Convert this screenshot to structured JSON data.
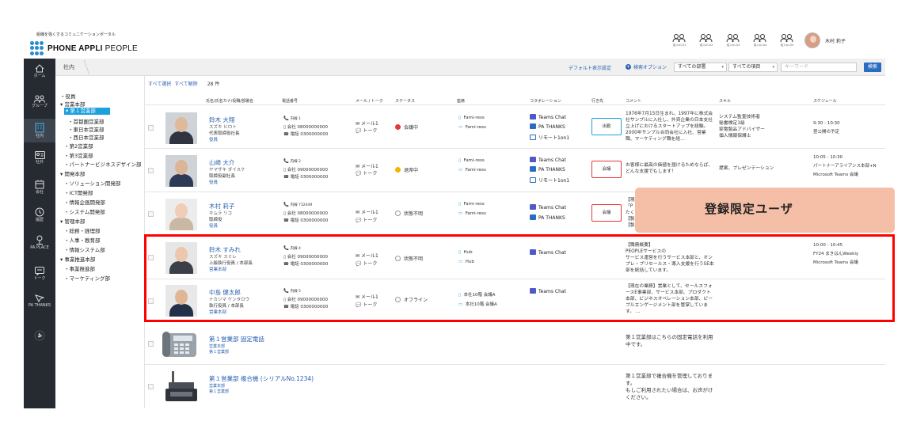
{
  "header": {
    "tagline": "組織を強くするコミュニケーションポータル",
    "logo_bold": "PHONE APPLI",
    "logo_light": " PEOPLE",
    "groups": [
      "成人UI-01",
      "成人UI-02",
      "成人UI-03",
      "成人UI-04",
      "成人UI-05"
    ],
    "user_name": "木村 莉子"
  },
  "sidebar": {
    "items": [
      {
        "label": "ホーム",
        "icon": "home-icon"
      },
      {
        "label": "グループ",
        "icon": "group-icon"
      },
      {
        "label": "社内",
        "icon": "building-icon"
      },
      {
        "label": "社外",
        "icon": "card-icon"
      },
      {
        "label": "会社",
        "icon": "company-icon"
      },
      {
        "label": "履歴",
        "icon": "history-icon"
      },
      {
        "label": "PA PLACE",
        "icon": "place-icon"
      },
      {
        "label": "トーク",
        "icon": "chat-icon"
      },
      {
        "label": "PA THANKS",
        "icon": "thanks-icon"
      },
      {
        "label": "",
        "icon": "pin-icon"
      }
    ]
  },
  "toolbar": {
    "breadcrumb": "社内",
    "default_display": "デフォルト表示設定",
    "search_option": "検索オプション",
    "dept_select": "すべての部署",
    "item_select": "すべての項目",
    "keyword_placeholder": "キーワード",
    "search_button": "検索"
  },
  "tree": {
    "nodes": [
      "・役員",
      "▾ 営業本部",
      "▾ 第１営業部",
      "・首都圏営業部",
      "・東日本営業部",
      "・西日本営業部",
      "・第2営業部",
      "・第3営業部",
      "・パートナービジネスデザイン部",
      "▾ 開発本部",
      "・ソリューション開発部",
      "・ICT開発部",
      "・情報企画開発部",
      "・システム開発部",
      "▾ 管理本部",
      "・総務・経理部",
      "・人事・教育部",
      "・情報システム部",
      "▾ 事業推進本部",
      "・事業推進部",
      "・マーケティング部"
    ]
  },
  "list": {
    "select_all": "すべて選択",
    "deselect_all": "すべて解除",
    "count": "28 件",
    "columns": [
      "氏名/氏名カナ/役職/部署名",
      "電話番号",
      "メール / トーク",
      "ステータス",
      "座席",
      "コラボレーション",
      "行き先",
      "コメント",
      "スキル",
      "スケジュール"
    ],
    "rows": [
      {
        "name": "鈴木 大翔",
        "kana": "スズキ ヒロト",
        "title": "代表取締役社長",
        "dept": "役員",
        "ext": "内線 1",
        "company": "会社 08000000000",
        "tel": "電話 0300000000",
        "mail": "メール1",
        "talk": "トーク",
        "status": "会議中",
        "status_color": "#e53935",
        "seat1": "Fami-ress",
        "seat2": "Fami-ress",
        "collab": [
          "Teams Chat",
          "PA THANKS",
          "リモート1on1"
        ],
        "dest": "出勤",
        "dest_color": "#1ea0dc",
        "comment": "1976年7月15日生まれ。1997年に株式会社サンプルに入社し、外資企業の日本支社立上げにおけるスタートアップを経験。2000年サンプル合同会社に入社、営業職、マーケティング職を経…",
        "skill": "システム監査技術者\n秘書検定1級\n家電製品アドバイザー\n個人情報保護士",
        "sched1": "9:30 - 10:30",
        "sched2": "昼公開の予定"
      },
      {
        "name": "山崎 大介",
        "kana": "ヤマザキ ダイスケ",
        "title": "取締役副社長",
        "dept": "役員",
        "ext": "内線 2",
        "company": "会社 09000000000",
        "tel": "電話 0300000000",
        "mail": "メール1",
        "talk": "トーク",
        "status": "退席中",
        "status_color": "#f5b400",
        "seat1": "Fami-ress",
        "seat2": "Fami-ress",
        "collab": [
          "Teams Chat",
          "PA THANKS",
          "リモート1on1"
        ],
        "dest": "会議",
        "dest_color": "#e53935",
        "comment": "お客様に最高の価値を届けるためならば、どんな支援でもします！",
        "skill": "提案、プレゼンテーション",
        "sched1": "10:05 - 10:30",
        "sched2": "パートナーアライアンス本部+N",
        "sched3": "Microsoft Teams 会議"
      },
      {
        "name": "木村 莉子",
        "kana": "キムラ リコ",
        "title": "取締役",
        "dept": "役員",
        "ext": "内線 732449",
        "company": "会社 08000000000",
        "tel": "電話 0300000000",
        "mail": "メール1",
        "talk": "トーク",
        "status": "状態不明",
        "seat1": "Fami-ress",
        "seat2": "Fami-ress",
        "collab": [
          "Teams Chat",
          "PA THANKS"
        ],
        "dest": "会議",
        "dest_color": "#e53935",
        "comment": "【現\n「P\nたく\n【製\n【製"
      },
      {
        "name": "鈴木 すみれ",
        "kana": "スズキ スミレ",
        "title": "上級執行役員 / 本部長",
        "dept": "営業本部",
        "ext": "内線 4",
        "company": "会社 09000000000",
        "tel": "電話 0300000000",
        "mail": "メール1",
        "talk": "トーク",
        "status": "状態不明",
        "seat1": "Hub",
        "seat2": "Hub",
        "collab": [
          "Teams Chat"
        ],
        "comment": "【職務概要】\nPEOPLEサービスの\nサービス運営を行うサービス本部と、オンプレ・プリセールス・導入支援を行うSE本部を統括しています。",
        "sched1": "10:00 - 10:45",
        "sched2": "FY24 まきはんWeekly",
        "sched3": "Microsoft Teams 会議"
      },
      {
        "name": "中島 健太郎",
        "kana": "ナカジマ ケンタロウ",
        "title": "執行役員 / 本部長",
        "dept": "営業本部",
        "ext": "内線 5",
        "company": "会社 09000000000",
        "tel": "電話 0300000000",
        "mail": "メール1",
        "talk": "トーク",
        "status": "オフライン",
        "seat1": "本社10階 会議A",
        "seat2": "本社10階 会議A",
        "collab": [
          "Teams Chat"
        ],
        "comment": "【現在の業務】営業として、セールスフォースE事業部、サービス本部、プロダクト本部、ビジネスオペレーション本部、ピープルエンゲージメント部を管掌しています。 …"
      },
      {
        "name": "第１営業部 固定電話",
        "dept1": "営業本部",
        "dept2": "第１営業部",
        "comment": "第１営業部はこちらの固定電話を利用中です。"
      },
      {
        "name": "第１営業部 複合機 (シリアルNo.1234)",
        "dept1": "営業本部",
        "dept2": "第１営業部",
        "comment": "第１営業部で複合機を管理しております。\nもしご利用されたい場合は、お声がけください。"
      }
    ]
  },
  "overlay": {
    "label": "登録限定ユーザ"
  },
  "colors": {
    "accent": "#1ea0dc",
    "highlight": "#ff0000",
    "overlay": "#f4baa0",
    "sidebar": "#262a31"
  }
}
